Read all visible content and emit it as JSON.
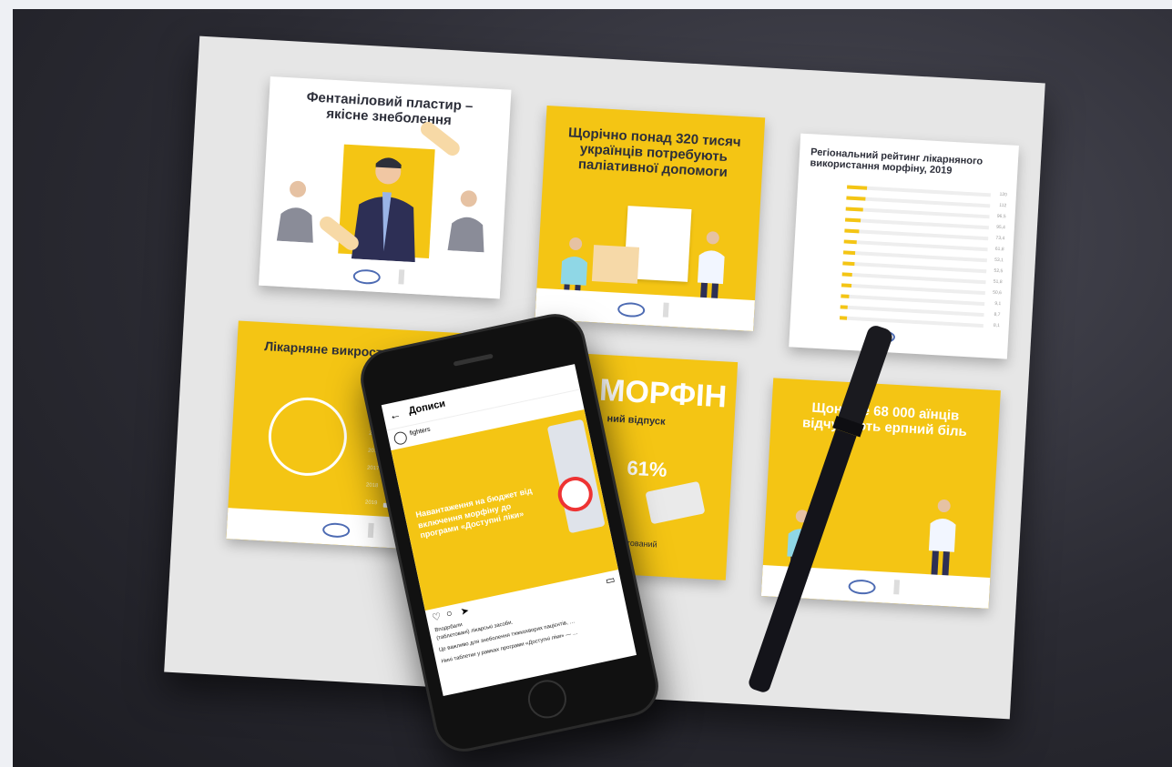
{
  "cards": {
    "fentanyl_title": "Фентаніловий пластир – якісне знеболення",
    "need_title": "Щорічно понад 320 тисяч українців потребують паліативної допомоги",
    "rating_title": "Регіональний рейтинг лікарняного використання морфіну, 2019",
    "hospital_title": "Лікарняне викрост",
    "morphine_title": "МОРФІН",
    "morphine_sub": "ний відпуск",
    "morphine_percent": "61%",
    "morphine_foot": "ктований",
    "pain_title": "Щонай е 68 000 аїнців відчувають ерпний біль"
  },
  "rating_rows": [
    {
      "value": "120",
      "fill": 0.14
    },
    {
      "value": "112",
      "fill": 0.13
    },
    {
      "value": "96,5",
      "fill": 0.12
    },
    {
      "value": "95,4",
      "fill": 0.11
    },
    {
      "value": "73,4",
      "fill": 0.1
    },
    {
      "value": "61,8",
      "fill": 0.09
    },
    {
      "value": "53,1",
      "fill": 0.08
    },
    {
      "value": "52,5",
      "fill": 0.08
    },
    {
      "value": "51,8",
      "fill": 0.07
    },
    {
      "value": "50,6",
      "fill": 0.07
    },
    {
      "value": "9,1",
      "fill": 0.06
    },
    {
      "value": "8,7",
      "fill": 0.05
    },
    {
      "value": "8,1",
      "fill": 0.05
    }
  ],
  "hospital_rows": [
    {
      "year": "2012",
      "value": "",
      "fill": 0.55
    },
    {
      "year": "2013",
      "value": "",
      "fill": 0.0
    },
    {
      "year": "2014",
      "value": "10,6",
      "fill": 0.65
    },
    {
      "year": "2015",
      "value": "21,1",
      "fill": 0.8
    },
    {
      "year": "2016",
      "value": "11,7",
      "fill": 0.32
    },
    {
      "year": "2017",
      "value": "15,4",
      "fill": 0.5
    },
    {
      "year": "2018",
      "value": "14,7",
      "fill": 0.47
    },
    {
      "year": "2019",
      "value": "19,4",
      "fill": 0.62
    }
  ],
  "phone": {
    "header": "Дописи",
    "account": "fighters",
    "post_text": "Навантаження на бюджет від включення морфіну до програми «Доступні ліки»",
    "caption_line1": "Вподобали",
    "caption_line2": "(таблетовані) лікарські засоби.",
    "caption_line3": "Це важливо для знеболення тяжкохворих пацієнтів, …",
    "caption_line4": "Нині таблетки у рамках програми «Доступні ліки» — …"
  },
  "colors": {
    "accent": "#f4c514",
    "dark": "#2d2f3a",
    "desk": "#2b2b33"
  }
}
